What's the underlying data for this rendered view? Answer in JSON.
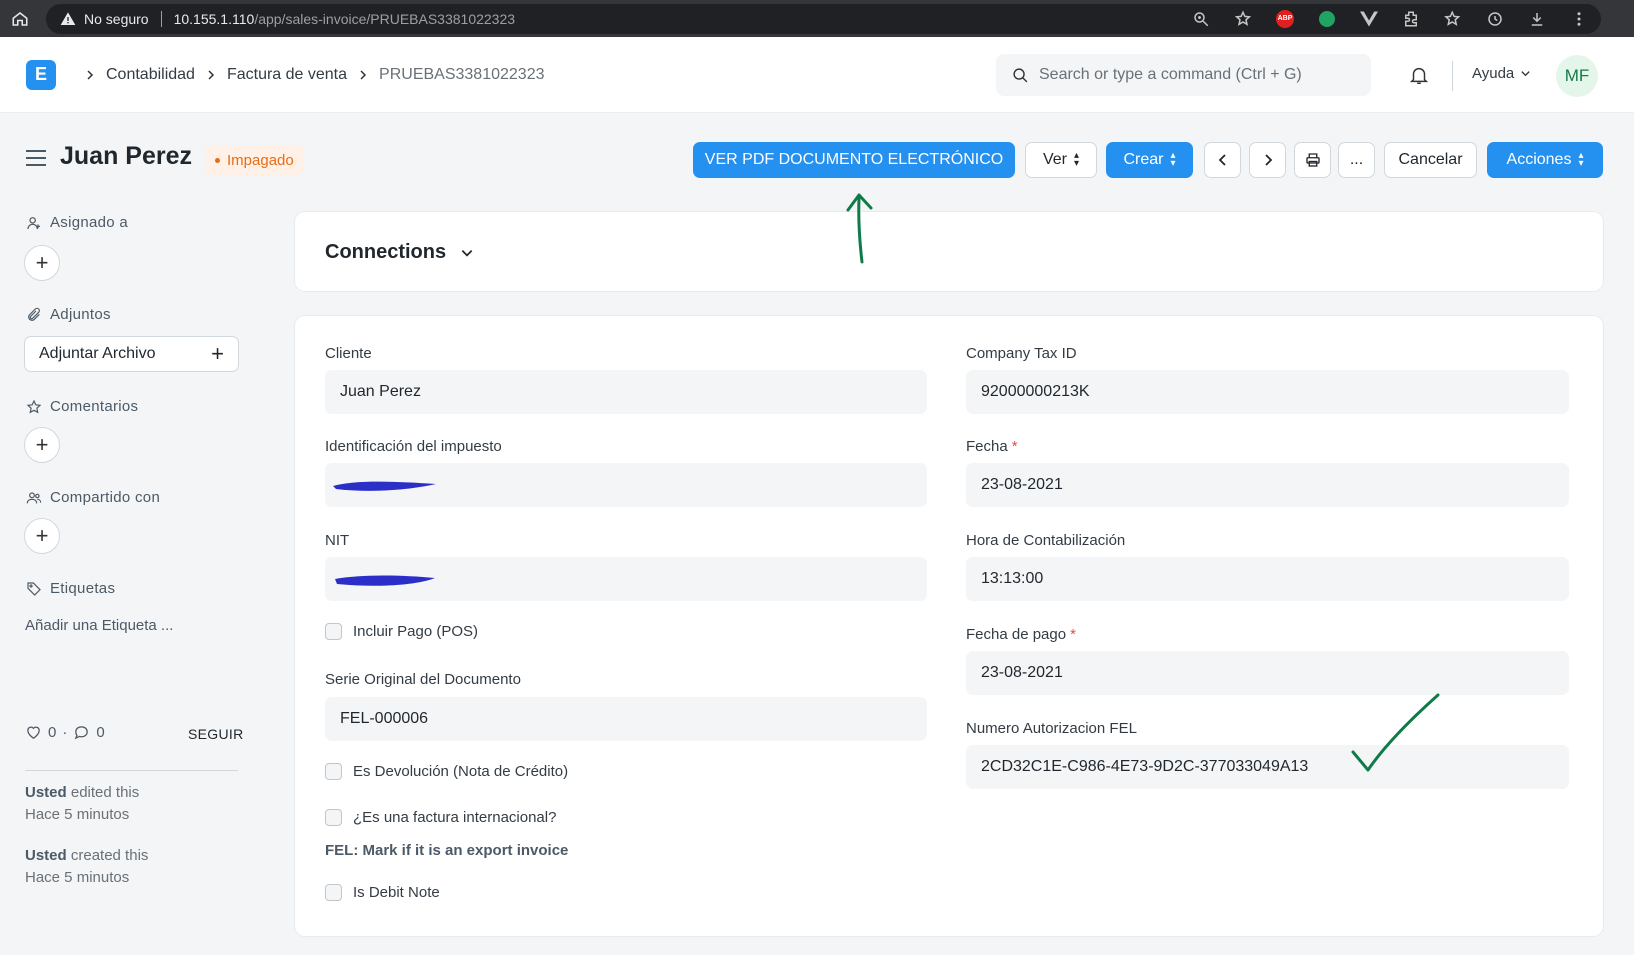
{
  "browser": {
    "security_label": "No seguro",
    "url_host": "10.155.1.110",
    "url_path": "/app/sales-invoice/PRUEBAS3381022323",
    "extension_abp": "ABP"
  },
  "navbar": {
    "logo_letter": "E",
    "breadcrumbs": [
      "Contabilidad",
      "Factura de venta",
      "PRUEBAS3381022323"
    ],
    "search_placeholder": "Search or type a command (Ctrl + G)",
    "help_label": "Ayuda",
    "avatar_initials": "MF"
  },
  "page": {
    "title": "Juan Perez",
    "status": "Impagado",
    "status_color": "#e86c13",
    "buttons": {
      "pdf": "VER PDF DOCUMENTO ELECTRÓNICO",
      "view": "Ver",
      "create": "Crear",
      "more": "...",
      "cancel": "Cancelar",
      "actions": "Acciones"
    }
  },
  "sidebar": {
    "assigned": "Asignado a",
    "attachments": "Adjuntos",
    "attach_button": "Adjuntar Archivo",
    "comments": "Comentarios",
    "shared": "Compartido con",
    "tags": "Etiquetas",
    "add_tag": "Añadir una Etiqueta ...",
    "likes": "0",
    "comment_count": "0",
    "follow": "SEGUIR",
    "activity": [
      {
        "user": "Usted",
        "action": "edited this",
        "time": "Hace 5 minutos"
      },
      {
        "user": "Usted",
        "action": "created this",
        "time": "Hace 5 minutos"
      }
    ]
  },
  "connections": {
    "title": "Connections"
  },
  "form": {
    "left": {
      "cliente_label": "Cliente",
      "cliente_value": "Juan Perez",
      "tax_id_label": "Identificación del impuesto",
      "nit_label": "NIT",
      "pos_label": "Incluir Pago (POS)",
      "serie_label": "Serie Original del Documento",
      "serie_value": "FEL-000006",
      "devolucion_label": "Es Devolución (Nota de Crédito)",
      "internacional_label": "¿Es una factura internacional?",
      "fel_note": "FEL: Mark if it is an export invoice",
      "debit_label": "Is Debit Note"
    },
    "right": {
      "company_tax_label": "Company Tax ID",
      "company_tax_value": "92000000213K",
      "fecha_label": "Fecha",
      "fecha_value": "23-08-2021",
      "hora_label": "Hora de Contabilización",
      "hora_value": "13:13:00",
      "fecha_pago_label": "Fecha de pago",
      "fecha_pago_value": "23-08-2021",
      "fel_label": "Numero Autorizacion FEL",
      "fel_value": "2CD32C1E-C986-4E73-9D2C-377033049A13"
    },
    "required_mark": "*"
  }
}
